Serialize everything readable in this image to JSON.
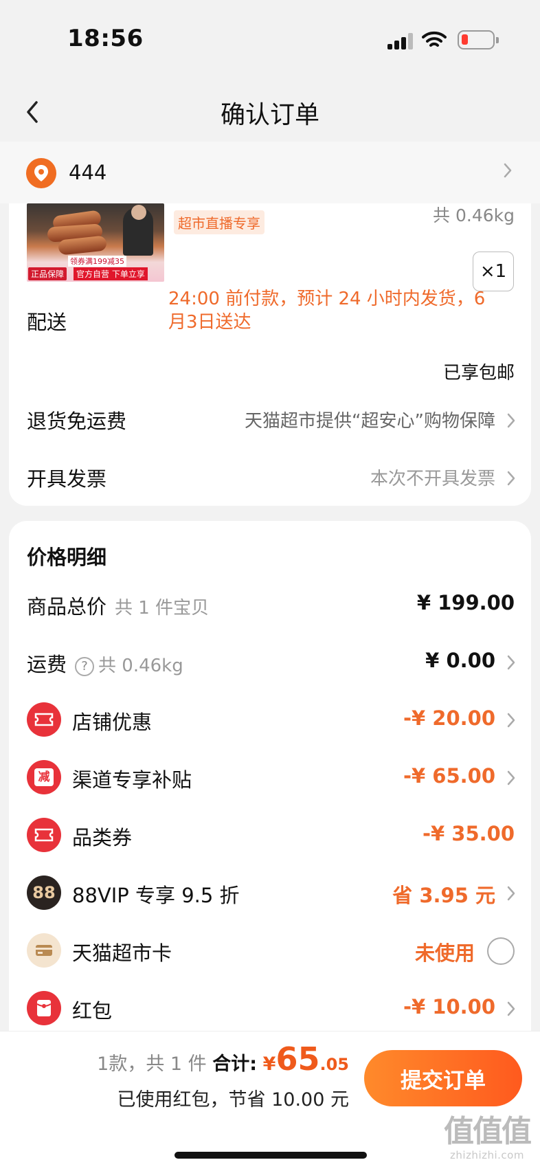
{
  "status_bar": {
    "time": "18:56"
  },
  "nav": {
    "title": "确认订单"
  },
  "address": {
    "text": "444"
  },
  "product": {
    "image_badge_genuine": "正品保障",
    "image_badge_self": "官方自营 下单立享",
    "image_badge_coupon": "领券满199减35",
    "tag": "超市直播专享",
    "weight": "共 0.46kg",
    "quantity": "×1"
  },
  "delivery": {
    "label": "配送",
    "note": "24:00 前付款，预计 24 小时内发货，6 月3日送达",
    "shipping": "已享包邮"
  },
  "return_shipping": {
    "label": "退货免运费",
    "value": "天猫超市提供“超安心”购物保障"
  },
  "invoice": {
    "label": "开具发票",
    "value": "本次不开具发票"
  },
  "price_detail": {
    "title": "价格明细",
    "rows": [
      {
        "label": "商品总价",
        "sub": "共 1 件宝贝",
        "value": "¥ 199.00"
      },
      {
        "label": "运费",
        "sub": "共 0.46kg",
        "help": "?",
        "value": "¥ 0.00"
      },
      {
        "label": "店铺优惠",
        "value": "-¥ 20.00",
        "icon": "ticket-icon"
      },
      {
        "label": "渠道专享补贴",
        "value": "-¥ 65.00",
        "icon": "discount-icon",
        "icon_text": "减"
      },
      {
        "label": "品类券",
        "value": "-¥ 35.00",
        "icon": "ticket-icon"
      },
      {
        "label": "88VIP 专享 9.5 折",
        "value": "省 3.95 元",
        "icon": "vip-88-icon",
        "icon_text": "88"
      },
      {
        "label": "天猫超市卡",
        "value": "未使用",
        "icon": "card-icon"
      },
      {
        "label": "红包",
        "value": "-¥ 10.00",
        "icon": "red-packet-icon"
      }
    ]
  },
  "footer": {
    "count": "1款，共 1 件",
    "total_label": "合计:",
    "currency": "¥",
    "total_int": "65",
    "total_dec": ".05",
    "saving": "已使用红包，节省 10.00 元",
    "submit": "提交订单"
  },
  "watermark": {
    "glyphs": "值值值",
    "url": "zhizhizhi.com"
  },
  "colors": {
    "accent": "#ef6a2b",
    "button_start": "#ff8a2b",
    "button_end": "#ff5a1e",
    "icon_red": "#e8323a"
  }
}
